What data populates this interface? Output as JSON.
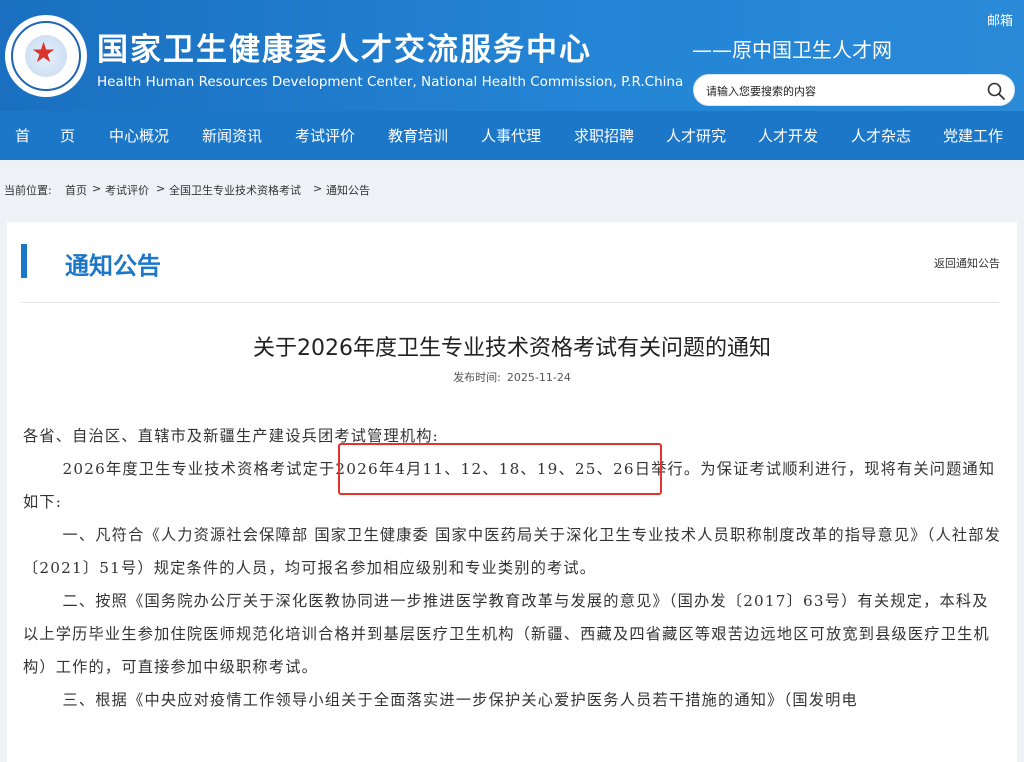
{
  "header": {
    "mail": "邮箱",
    "title_cn": "国家卫生健康委人才交流服务中心",
    "title_en": "Health Human Resources Development Center, National Health Commission, P.R.China",
    "subtitle": "——原中国卫生人才网",
    "search_placeholder": "请输入您要搜索的内容"
  },
  "nav": [
    {
      "label": "首　　页"
    },
    {
      "label": "中心概况"
    },
    {
      "label": "新闻资讯"
    },
    {
      "label": "考试评价"
    },
    {
      "label": "教育培训"
    },
    {
      "label": "人事代理"
    },
    {
      "label": "求职招聘"
    },
    {
      "label": "人才研究"
    },
    {
      "label": "人才开发"
    },
    {
      "label": "人才杂志"
    },
    {
      "label": "党建工作"
    }
  ],
  "breadcrumb": {
    "prefix": "当前位置:",
    "items": [
      "首页",
      "考试评价",
      "全国卫生专业技术资格考试",
      "通知公告"
    ],
    "sep": ">"
  },
  "section": {
    "title": "通知公告",
    "back_link": "返回通知公告"
  },
  "article": {
    "title": "关于2026年度卫生专业技术资格考试有关问题的通知",
    "date_label": "发布时间:",
    "date": "2025-11-24",
    "salutation": "各省、自治区、直辖市及新疆生产建设兵团考试管理机构:",
    "p1": "2026年度卫生专业技术资格考试定于2026年4月11、12、18、19、25、26日举行。为保证考试顺利进行，现将有关问题通知如下:",
    "p2": "一、凡符合《人力资源社会保障部 国家卫生健康委 国家中医药局关于深化卫生专业技术人员职称制度改革的指导意见》（人社部发〔2021〕51号）规定条件的人员，均可报名参加相应级别和专业类别的考试。",
    "p3": "二、按照《国务院办公厅关于深化医教协同进一步推进医学教育改革与发展的意见》（国办发〔2017〕63号）有关规定，本科及以上学历毕业生参加住院医师规范化培训合格并到基层医疗卫生机构（新疆、西藏及四省藏区等艰苦边远地区可放宽到县级医疗卫生机构）工作的，可直接参加中级职称考试。",
    "p4": "三、根据《中央应对疫情工作领导小组关于全面落实进一步保护关心爱护医务人员若干措施的通知》（国发明电"
  },
  "colors": {
    "brand_blue": "#1c77c9",
    "highlight_red": "#e3332b"
  },
  "icons": {
    "search": "search-icon",
    "logo": "emblem-logo"
  }
}
